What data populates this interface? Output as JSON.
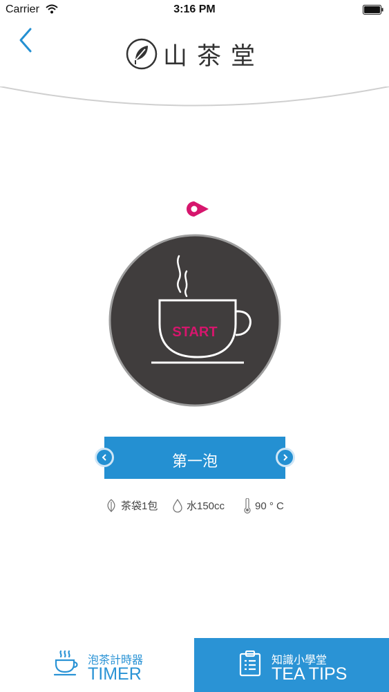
{
  "status_bar": {
    "carrier": "Carrier",
    "time": "3:16 PM"
  },
  "header": {
    "logo_text": "山茶堂",
    "back_icon": "chevron-left-icon"
  },
  "timer": {
    "start_label": "START",
    "steep_label": "第一泡"
  },
  "info": [
    {
      "icon": "leaf-icon",
      "text": "茶袋1包"
    },
    {
      "icon": "water-drop-icon",
      "text": "水150cc"
    },
    {
      "icon": "thermometer-icon",
      "text": "90 ° C"
    }
  ],
  "tabs": [
    {
      "icon": "teacup-icon",
      "sub": "泡茶計時器",
      "main": "TIMER"
    },
    {
      "icon": "clipboard-icon",
      "sub": "知識小學堂",
      "main": "TEA TIPS"
    }
  ],
  "colors": {
    "accent_blue": "#2490d2",
    "accent_pink": "#d6166d",
    "dial": "#403d3d"
  }
}
